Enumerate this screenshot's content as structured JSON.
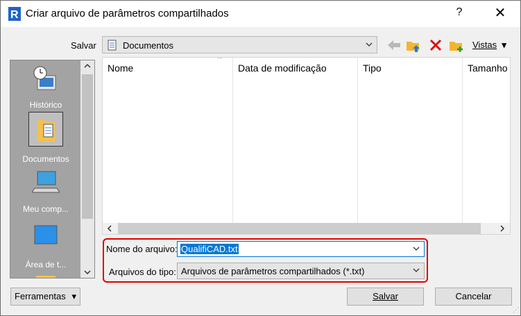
{
  "window": {
    "title": "Criar arquivo de parâmetros compartilhados",
    "help": "?",
    "close": "✕"
  },
  "location": {
    "label": "Salvar",
    "value": "Documentos"
  },
  "toolbar": {
    "views_label": "Vistas",
    "views_caret": "▾"
  },
  "places": [
    {
      "label": "Histórico",
      "icon": "history-icon"
    },
    {
      "label": "Documentos",
      "icon": "documents-folder-icon",
      "selected": true
    },
    {
      "label": "Meu comp...",
      "icon": "computer-icon"
    },
    {
      "label": "Área de t...",
      "icon": "desktop-icon"
    }
  ],
  "columns": [
    "Nome",
    "Data de modificação",
    "Tipo",
    "Tamanho"
  ],
  "file_name": {
    "label": "Nome do arquivo:",
    "value": "QualifiCAD.txt"
  },
  "file_type": {
    "label": "Arquivos do tipo:",
    "value": "Arquivos de parâmetros compartilhados (*.txt)"
  },
  "buttons": {
    "tools": "Ferramentas",
    "save": "Salvar",
    "cancel": "Cancelar"
  },
  "colors": {
    "accent": "#0078d7",
    "highlight_border": "#e00000",
    "places_bg": "#a3a3a3"
  }
}
